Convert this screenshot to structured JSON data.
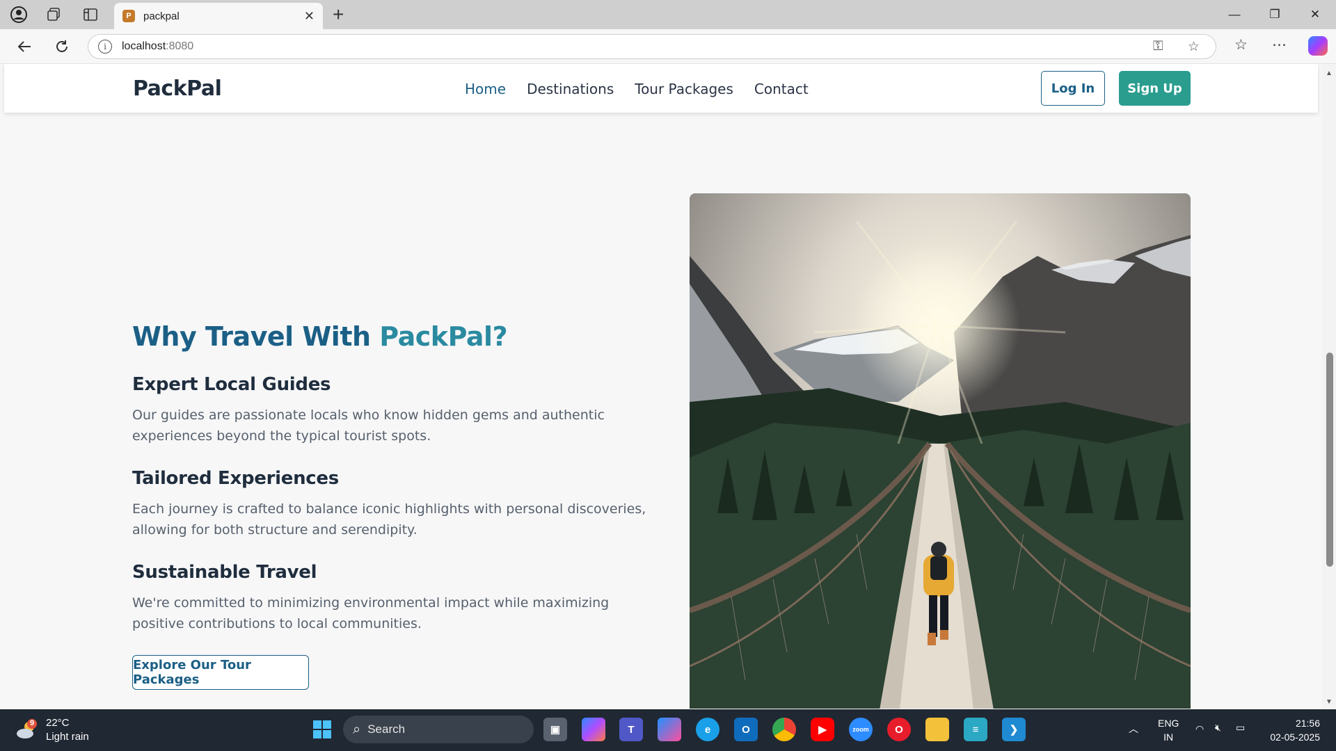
{
  "browser": {
    "tab_title": "packpal",
    "url_host": "localhost",
    "url_port": ":8080"
  },
  "site": {
    "logo": "PackPal",
    "nav": [
      "Home",
      "Destinations",
      "Tour Packages",
      "Contact"
    ],
    "login_label": "Log In",
    "signup_label": "Sign Up"
  },
  "section": {
    "title_part1": "Why Travel With ",
    "title_part2": "PackPal?",
    "features": [
      {
        "title": "Expert Local Guides",
        "text": "Our guides are passionate locals who know hidden gems and authentic experiences beyond the typical tourist spots."
      },
      {
        "title": "Tailored Experiences",
        "text": "Each journey is crafted to balance iconic highlights with personal discoveries, allowing for both structure and serendipity."
      },
      {
        "title": "Sustainable Travel",
        "text": "We're committed to minimizing environmental impact while maximizing positive contributions to local communities."
      }
    ],
    "cta_label": "Explore Our Tour Packages"
  },
  "taskbar": {
    "weather_temp": "22°C",
    "weather_desc": "Light rain",
    "weather_badge": "9",
    "search_label": "Search",
    "lang_line1": "ENG",
    "lang_line2": "IN",
    "time": "21:56",
    "date": "02-05-2025"
  },
  "colors": {
    "brand_dark": "#1b5f86",
    "brand_teal": "#2a9d8f",
    "heading": "#1f2d3d"
  }
}
